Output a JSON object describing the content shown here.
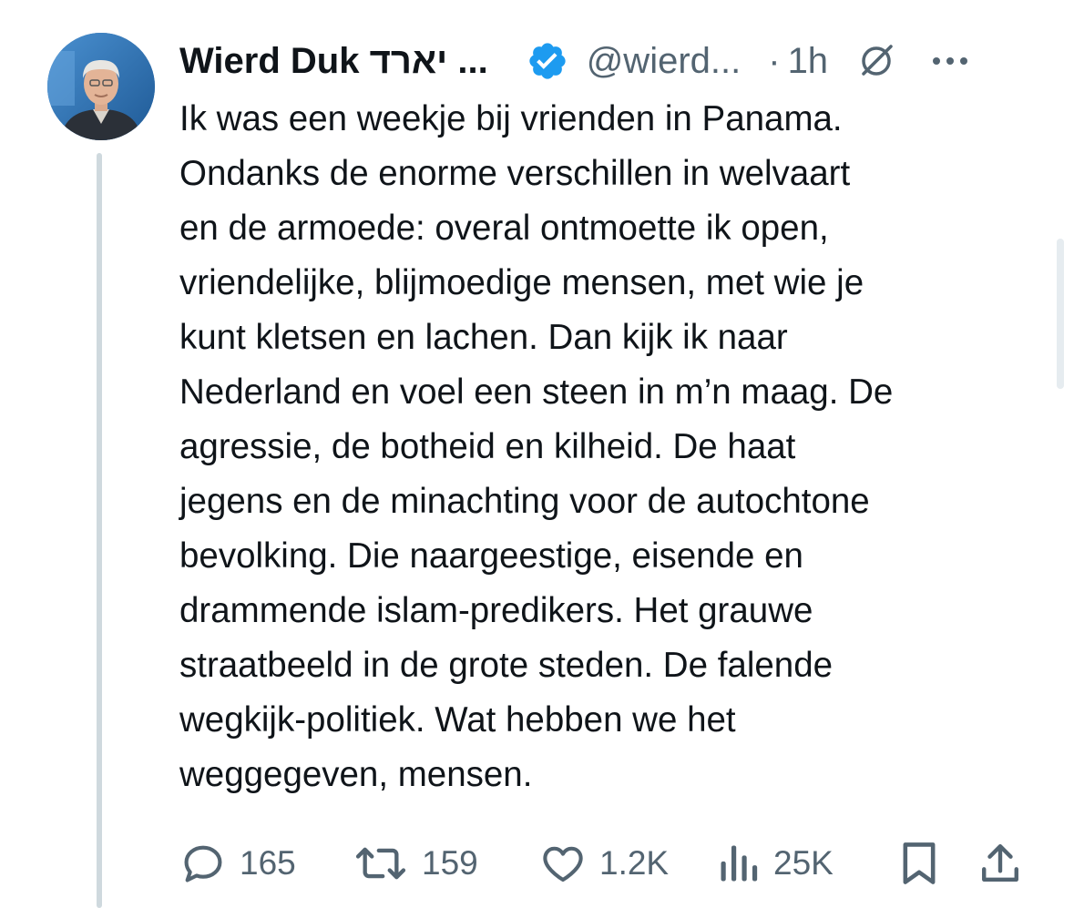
{
  "tweet": {
    "author_name": "Wierd Duk יארד ...",
    "handle": "@wierd...",
    "separator": "·",
    "time": "1h",
    "text_lines": [
      "Ik was een weekje bij vrienden in Panama.",
      "Ondanks de enorme verschillen in welvaart",
      "en de armoede: overal ontmoette ik open,",
      "vriendelijke, blijmoedige mensen, met wie je",
      "kunt kletsen en lachen. Dan kijk ik naar",
      "Nederland en voel een steen in m’n maag. De",
      "agressie, de botheid en kilheid. De haat",
      "jegens en de minachting voor de autochtone",
      "bevolking. Die naargeestige, eisende en",
      "drammende islam-predikers. Het grauwe",
      "straatbeeld in de grote steden. De falende",
      "wegkijk-politiek. Wat hebben we het",
      "weggegeven, mensen."
    ],
    "actions": {
      "replies": "165",
      "reposts": "159",
      "likes": "1.2K",
      "views": "25K"
    }
  },
  "icons": {
    "verified": "verified-badge-icon",
    "grok": "grok-icon",
    "more": "more-icon",
    "reply": "reply-icon",
    "repost": "repost-icon",
    "like": "like-icon",
    "views": "views-icon",
    "bookmark": "bookmark-icon",
    "share": "share-icon"
  },
  "colors": {
    "verified_blue": "#1d9bf0",
    "text": "#0f1419",
    "secondary": "#536471",
    "thread_line": "#cfd9de"
  }
}
